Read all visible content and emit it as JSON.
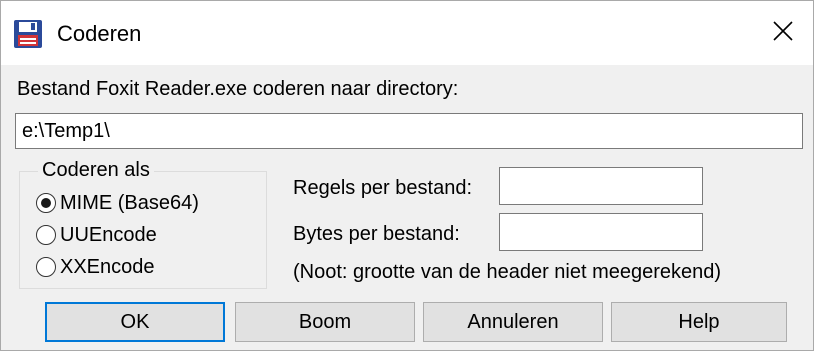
{
  "window": {
    "title": "Coderen",
    "icon": "floppy-disk-icon",
    "close_icon": "close-icon"
  },
  "prompt": "Bestand Foxit Reader.exe coderen naar directory:",
  "directory_value": "e:\\Temp1\\",
  "encoding_group": {
    "legend": "Coderen als",
    "options": [
      {
        "label": "MIME (Base64)",
        "checked": true
      },
      {
        "label": "UUEncode",
        "checked": false
      },
      {
        "label": "XXEncode",
        "checked": false
      }
    ]
  },
  "lines_per_file": {
    "label": "Regels per bestand:",
    "value": ""
  },
  "bytes_per_file": {
    "label": "Bytes per bestand:",
    "value": ""
  },
  "note": "(Noot: grootte van de header niet meegerekend)",
  "buttons": {
    "ok": "OK",
    "boom": "Boom",
    "cancel": "Annuleren",
    "help": "Help"
  },
  "colors": {
    "dialog_background": "#f0f0f0",
    "default_button_border": "#0078d7",
    "icon_blue": "#2b4a9a",
    "icon_red": "#d13438"
  }
}
